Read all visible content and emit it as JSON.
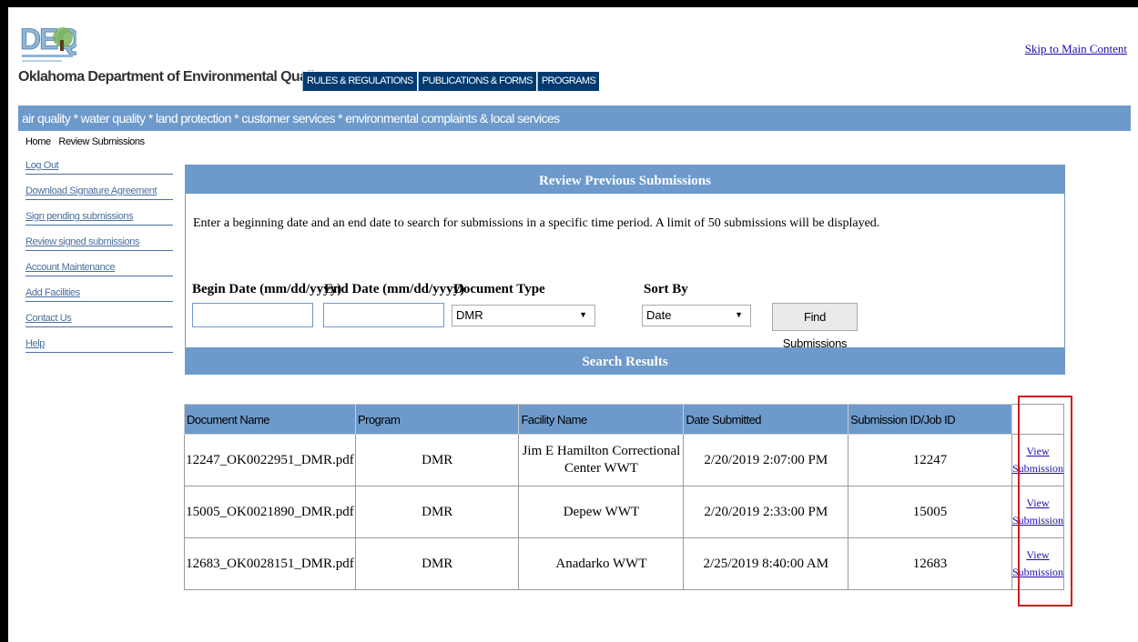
{
  "header": {
    "org_name": "Oklahoma Department of Environmental Quality",
    "skip_link": "Skip to Main Content",
    "nav_tabs": [
      "RULES & REGULATIONS",
      "PUBLICATIONS & FORMS",
      "PROGRAMS"
    ],
    "sub_nav": "air quality * water quality * land protection * customer services * environmental complaints & local services"
  },
  "breadcrumb": [
    "Home",
    "Review Submissions"
  ],
  "sidebar": {
    "items": [
      "Log Out",
      "Download Signature Agreement",
      "Sign pending submissions",
      "Review signed submissions",
      "Account Maintenance",
      "Add Facilities",
      "Contact Us",
      "Help"
    ]
  },
  "panel": {
    "title": "Review Previous Submissions",
    "instructions": "Enter a beginning date and an end date to search for submissions in a specific time period. A limit of 50 submissions will be displayed.",
    "begin_date_label": "Begin Date (mm/dd/yyyy)",
    "end_date_label": "End Date (mm/dd/yyyy)",
    "begin_date_value": "",
    "end_date_value": "",
    "doc_type_label": "Document Type",
    "doc_type_value": "DMR",
    "sort_by_label": "Sort By",
    "sort_by_value": "Date",
    "find_button": "Find Submissions",
    "results_title": "Search Results"
  },
  "results": {
    "columns": [
      "Document Name",
      "Program",
      "Facility Name",
      "Date Submitted",
      "Submission ID/Job ID",
      ""
    ],
    "rows": [
      {
        "doc": "12247_OK0022951_DMR.pdf",
        "program": "DMR",
        "facility": "Jim E Hamilton Correctional Center WWT",
        "date": "2/20/2019 2:07:00 PM",
        "id": "12247",
        "link": "View Submission"
      },
      {
        "doc": "15005_OK0021890_DMR.pdf",
        "program": "DMR",
        "facility": "Depew WWT",
        "date": "2/20/2019 2:33:00 PM",
        "id": "15005",
        "link": "View Submission"
      },
      {
        "doc": "12683_OK0028151_DMR.pdf",
        "program": "DMR",
        "facility": "Anadarko WWT",
        "date": "2/25/2019 8:40:00 AM",
        "id": "12683",
        "link": "View Submission"
      }
    ]
  },
  "colors": {
    "brand_blue": "#6d9acb",
    "nav_dark": "#003a70",
    "highlight_red": "#d11b1b",
    "link_blue": "#1a0dab"
  }
}
